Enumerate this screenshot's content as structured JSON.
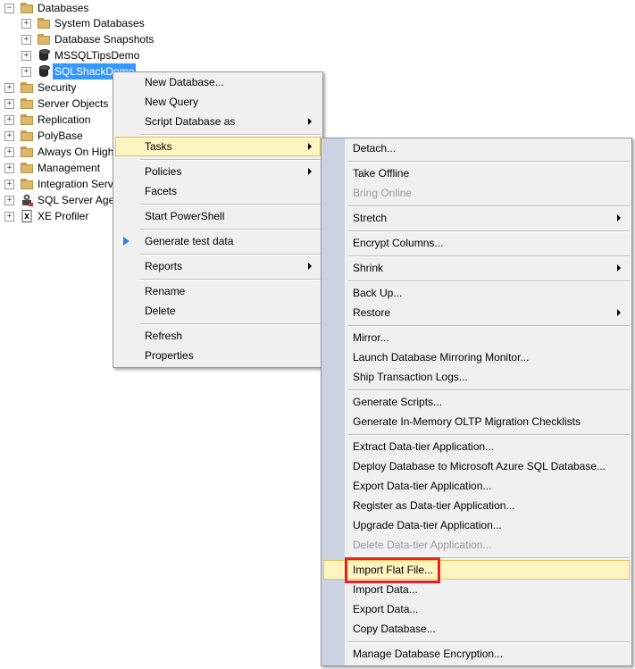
{
  "tree": {
    "items": [
      {
        "label": "Databases",
        "expander": "−",
        "icon": "folder-icon"
      },
      {
        "label": "System Databases",
        "expander": "+",
        "icon": "folder-icon"
      },
      {
        "label": "Database Snapshots",
        "expander": "+",
        "icon": "folder-icon"
      },
      {
        "label": "MSSQLTipsDemo",
        "expander": "+",
        "icon": "database-icon"
      },
      {
        "label": "SQLShackDemo",
        "expander": "+",
        "icon": "database-icon",
        "selected": true
      },
      {
        "label": "Security",
        "expander": "+",
        "icon": "folder-icon"
      },
      {
        "label": "Server Objects",
        "expander": "+",
        "icon": "folder-icon"
      },
      {
        "label": "Replication",
        "expander": "+",
        "icon": "folder-icon"
      },
      {
        "label": "PolyBase",
        "expander": "+",
        "icon": "folder-icon"
      },
      {
        "label": "Always On High",
        "expander": "+",
        "icon": "folder-icon"
      },
      {
        "label": "Management",
        "expander": "+",
        "icon": "folder-icon"
      },
      {
        "label": "Integration Serv",
        "expander": "+",
        "icon": "folder-icon"
      },
      {
        "label": "SQL Server Ager",
        "expander": "+",
        "icon": "sql-agent-icon"
      },
      {
        "label": "XE Profiler",
        "expander": "+",
        "icon": "xe-profiler-icon"
      }
    ]
  },
  "context_menu": {
    "items": [
      {
        "label": "New Database..."
      },
      {
        "label": "New Query"
      },
      {
        "label": "Script Database as",
        "submenu": true
      },
      {
        "label": "Tasks",
        "submenu": true,
        "highlighted": true
      },
      {
        "label": "Policies",
        "submenu": true
      },
      {
        "label": "Facets"
      },
      {
        "label": "Start PowerShell"
      },
      {
        "label": "Generate test data",
        "icon": "play-icon"
      },
      {
        "label": "Reports",
        "submenu": true
      },
      {
        "label": "Rename"
      },
      {
        "label": "Delete"
      },
      {
        "label": "Refresh"
      },
      {
        "label": "Properties"
      }
    ]
  },
  "tasks_menu": {
    "items": [
      {
        "label": "Detach..."
      },
      {
        "label": "Take Offline"
      },
      {
        "label": "Bring Online",
        "disabled": true
      },
      {
        "label": "Stretch",
        "submenu": true
      },
      {
        "label": "Encrypt Columns..."
      },
      {
        "label": "Shrink",
        "submenu": true
      },
      {
        "label": "Back Up..."
      },
      {
        "label": "Restore",
        "submenu": true
      },
      {
        "label": "Mirror..."
      },
      {
        "label": "Launch Database Mirroring Monitor..."
      },
      {
        "label": "Ship Transaction Logs..."
      },
      {
        "label": "Generate Scripts..."
      },
      {
        "label": "Generate In-Memory OLTP Migration Checklists"
      },
      {
        "label": "Extract Data-tier Application..."
      },
      {
        "label": "Deploy Database to Microsoft Azure SQL Database..."
      },
      {
        "label": "Export Data-tier Application..."
      },
      {
        "label": "Register as Data-tier Application..."
      },
      {
        "label": "Upgrade Data-tier Application..."
      },
      {
        "label": "Delete Data-tier Application...",
        "disabled": true
      },
      {
        "label": "Import Flat File...",
        "highlighted": true,
        "annotated": true
      },
      {
        "label": "Import Data..."
      },
      {
        "label": "Export Data..."
      },
      {
        "label": "Copy Database..."
      },
      {
        "label": "Manage Database Encryption..."
      }
    ]
  },
  "colors": {
    "highlight": "#fdf4bf",
    "highlight_border": "#e5c365",
    "selection": "#3399ff",
    "annotation": "#e2231a",
    "submenu_gutter": "#cbd3e3"
  }
}
